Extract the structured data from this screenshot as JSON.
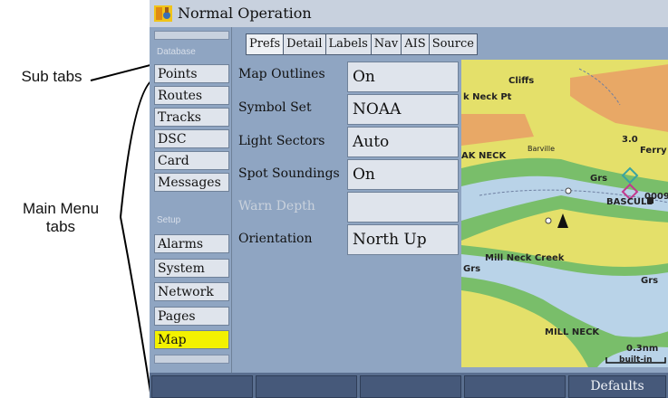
{
  "annotations": {
    "sub_tabs": "Sub tabs",
    "main_menu_line1": "Main Menu",
    "main_menu_line2": "tabs"
  },
  "window": {
    "title": "Normal Operation"
  },
  "sidebar": {
    "section_database": "Database",
    "section_setup": "Setup",
    "items": [
      {
        "label": "Points"
      },
      {
        "label": "Routes"
      },
      {
        "label": "Tracks"
      },
      {
        "label": "DSC"
      },
      {
        "label": "Card"
      },
      {
        "label": "Messages"
      },
      {
        "label": "Alarms"
      },
      {
        "label": "System"
      },
      {
        "label": "Network"
      },
      {
        "label": "Pages"
      },
      {
        "label": "Map",
        "selected": true
      }
    ]
  },
  "subtabs": [
    {
      "label": "Prefs",
      "selected": true
    },
    {
      "label": "Detail"
    },
    {
      "label": "Labels"
    },
    {
      "label": "Nav"
    },
    {
      "label": "AIS"
    },
    {
      "label": "Source"
    }
  ],
  "prefs": [
    {
      "label": "Map Outlines",
      "value": "On"
    },
    {
      "label": "Symbol Set",
      "value": "NOAA"
    },
    {
      "label": "Light Sectors",
      "value": "Auto"
    },
    {
      "label": "Spot Soundings",
      "value": "On"
    },
    {
      "label": "Warn Depth",
      "value": "",
      "disabled": true
    },
    {
      "label": "Orientation",
      "value": "North Up"
    }
  ],
  "map": {
    "labels": {
      "cliffs": "Cliffs",
      "neck_pt": "k Neck Pt",
      "depth_3": "3.0",
      "barville": "Barville",
      "ferry": "Ferry",
      "ak_neck": "AK NECK",
      "grs1": "Grs",
      "bascule": "BASCULE",
      "marker_num": "0009",
      "mill_neck_creek": "Mill Neck Creek",
      "grs2": "Grs",
      "grs3": "Grs",
      "mill_neck": "MILL NECK",
      "scale": "0.3nm",
      "scale_sub": "built-in"
    }
  },
  "softkeys": {
    "defaults": "Defaults"
  },
  "colors": {
    "screen_bg": "#8fa5c2",
    "selected_item": "#f3f100",
    "land": "#e4e06a",
    "water": "#b9d3e8",
    "shoal": "#79be6a",
    "shore": "#e8a866"
  }
}
